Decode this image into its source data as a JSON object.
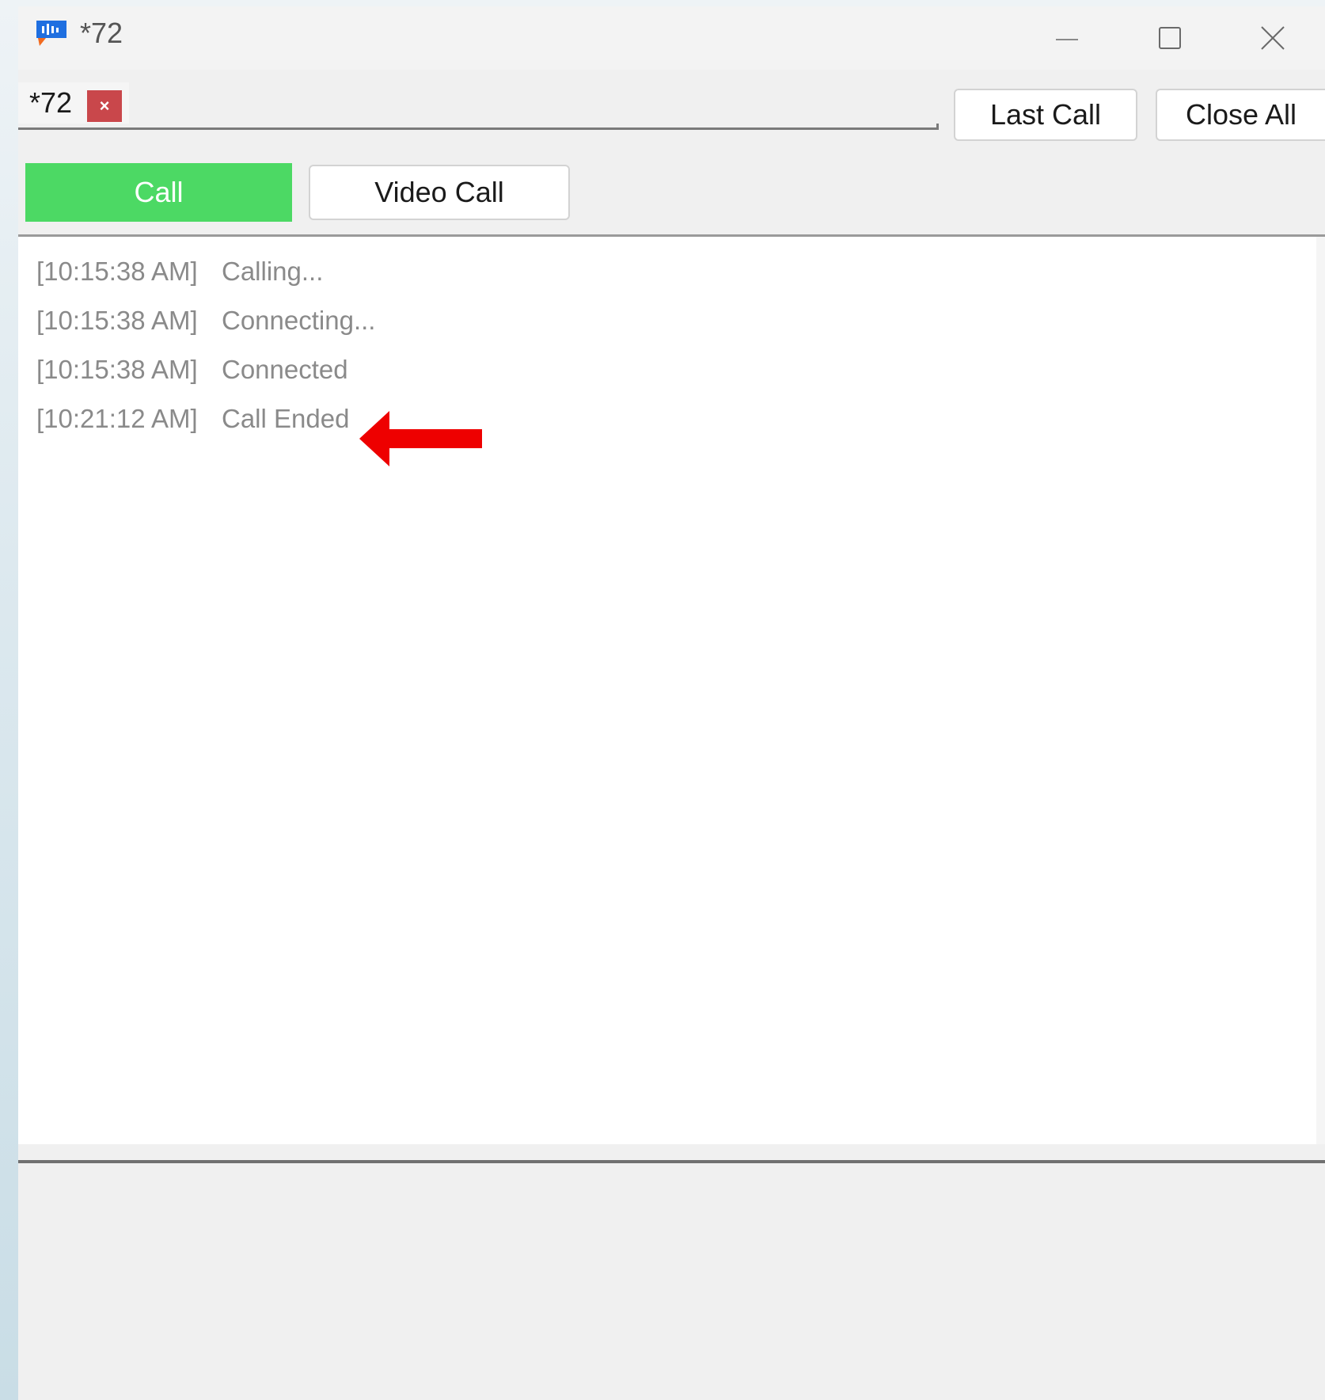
{
  "window": {
    "title": "*72",
    "controls": [
      "minimize",
      "maximize",
      "close"
    ]
  },
  "tabs": [
    {
      "label": "*72",
      "close_glyph": "×",
      "active": true
    }
  ],
  "toolbar": {
    "last_call_label": "Last Call",
    "close_all_label": "Close All"
  },
  "call_buttons": {
    "call_label": "Call",
    "video_call_label": "Video Call"
  },
  "log": [
    {
      "time": "[10:15:38 AM]",
      "message": "Calling..."
    },
    {
      "time": "[10:15:38 AM]",
      "message": "Connecting..."
    },
    {
      "time": "[10:15:38 AM]",
      "message": "Connected"
    },
    {
      "time": "[10:21:12 AM]",
      "message": "Call Ended"
    }
  ],
  "annotation": {
    "type": "arrow-left-icon",
    "color": "#ee0000",
    "points_to": "log.3"
  },
  "colors": {
    "call_button": "#4cd964",
    "tab_close": "#c9474b",
    "log_text": "#8a8a8a"
  },
  "input": {
    "value": "",
    "placeholder": ""
  }
}
